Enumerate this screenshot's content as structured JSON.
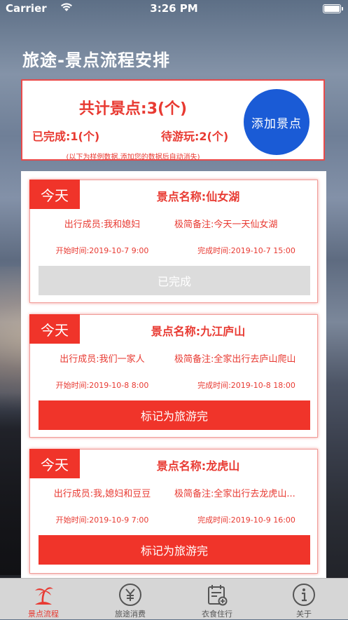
{
  "status_bar": {
    "carrier": "Carrier",
    "time": "3:26 PM"
  },
  "page_title": "旅途-景点流程安排",
  "summary": {
    "total": "共计景点:3(个)",
    "done": "已完成:1(个)",
    "todo": "待游玩:2(个)",
    "hint": "(以下为样例数据,添加您的数据后自动消失)",
    "add_button": "添加景点"
  },
  "cards": [
    {
      "today": "今天",
      "name": "景点名称:仙女湖",
      "members": "出行成员:我和媳妇",
      "note": "极简备注:今天一天仙女湖",
      "start": "开始时间:2019-10-7 9:00",
      "end": "完成时间:2019-10-7 15:00",
      "action": "已完成",
      "action_state": "done"
    },
    {
      "today": "今天",
      "name": "景点名称:九江庐山",
      "members": "出行成员:我们一家人",
      "note": "极简备注:全家出行去庐山爬山",
      "start": "开始时间:2019-10-8 8:00",
      "end": "完成时间:2019-10-8 18:00",
      "action": "标记为旅游完",
      "action_state": "pending"
    },
    {
      "today": "今天",
      "name": "景点名称:龙虎山",
      "members": "出行成员:我,媳妇和豆豆",
      "note": "极简备注:全家出行去龙虎山...",
      "start": "开始时间:2019-10-9 7:00",
      "end": "完成时间:2019-10-9 16:00",
      "action": "标记为旅游完",
      "action_state": "pending"
    }
  ],
  "tabs": [
    {
      "label": "景点流程",
      "icon": "palm-island-icon",
      "active": true
    },
    {
      "label": "旅途消费",
      "icon": "yen-coin-icon",
      "active": false
    },
    {
      "label": "衣食住行",
      "icon": "calendar-add-icon",
      "active": false
    },
    {
      "label": "关于",
      "icon": "info-circle-icon",
      "active": false
    }
  ],
  "colors": {
    "accent": "#f0342a",
    "add_button": "#1a5bd6",
    "done_button": "#dcdcdc"
  }
}
